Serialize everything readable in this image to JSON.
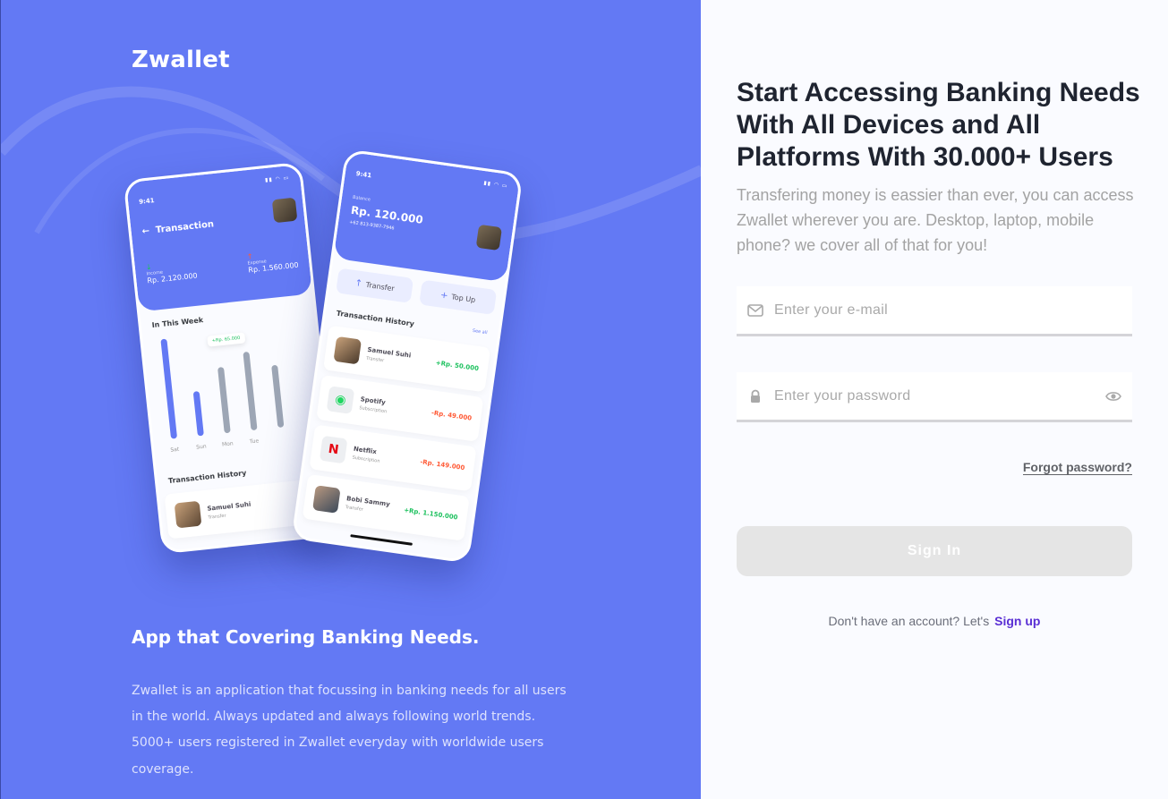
{
  "brand": {
    "name": "Zwallet"
  },
  "promo": {
    "tagline": "App that Covering Banking Needs.",
    "description": "Zwallet is an application that focussing in banking needs for all users in the world. Always updated and always following world trends. 5000+ users registered in Zwallet everyday with worldwide users coverage."
  },
  "mockup_back": {
    "time": "9:41",
    "title": "Transaction",
    "income_label": "Income",
    "income_value": "Rp. 2.120.000",
    "expense_label": "Expense",
    "expense_value": "Rp. 1.560.000",
    "week_title": "In This Week",
    "tooltip": "+Rp. 65.000",
    "days": [
      "Sat",
      "Sun",
      "Mon",
      "Tue"
    ],
    "history_title": "Transaction History",
    "history_name": "Samuel Suhi",
    "history_type": "Transfer"
  },
  "mockup_front": {
    "time": "9:41",
    "balance_label": "Balance",
    "balance_value": "Rp. 120.000",
    "phone": "+62 813-9387-7946",
    "transfer_label": "Transfer",
    "topup_label": "Top Up",
    "history_title": "Transaction History",
    "see_all": "See all",
    "transactions": [
      {
        "name": "Samuel Suhi",
        "type": "Transfer",
        "amount": "+Rp. 50.000",
        "icon": "avatar-icon"
      },
      {
        "name": "Spotify",
        "type": "Subscription",
        "amount": "-Rp. 49.000",
        "icon": "spotify-icon"
      },
      {
        "name": "Netflix",
        "type": "Subscription",
        "amount": "-Rp. 149.000",
        "icon": "netflix-icon"
      },
      {
        "name": "Bobi Sammy",
        "type": "Transfer",
        "amount": "+Rp. 1.150.000",
        "icon": "avatar-icon"
      }
    ]
  },
  "login": {
    "headline": "Start Accessing Banking Needs With All Devices and All Platforms With 30.000+ Users",
    "subtext": "Transfering money is eassier than ever, you can access Zwallet wherever you are. Desktop, laptop, mobile phone? we cover all of that for you!",
    "email_placeholder": "Enter your e-mail",
    "password_placeholder": "Enter your password",
    "forgot_label": "Forgot password?",
    "signin_label": "Sign In",
    "signup_prompt": "Don't have an account? Let's",
    "signup_link": "Sign up"
  },
  "colors": {
    "primary": "#6379F4",
    "income": "#1EC15F",
    "expense": "#FF5B37",
    "signup": "#5A2FD4",
    "button_disabled": "#E5E5E5"
  }
}
